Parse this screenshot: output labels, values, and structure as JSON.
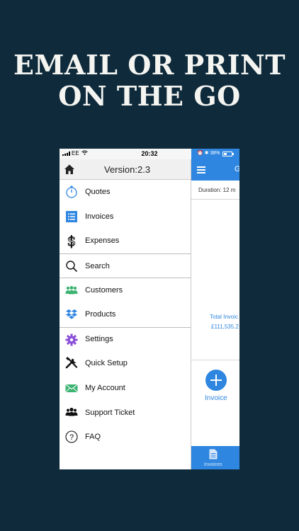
{
  "headline": {
    "line1": "EMAIL OR PRINT",
    "line2": "ON THE GO"
  },
  "status_bar": {
    "carrier": "EE",
    "time": "20:32",
    "battery_percent": "38%",
    "battery_level": 0.38
  },
  "drawer": {
    "version": "Version:2.3",
    "items": [
      {
        "label": "Quotes",
        "icon": "stopwatch-icon"
      },
      {
        "label": "Invoices",
        "icon": "list-icon"
      },
      {
        "label": "Expenses",
        "icon": "dollar-icon"
      },
      {
        "label": "Search",
        "icon": "search-icon"
      },
      {
        "label": "Customers",
        "icon": "people-icon"
      },
      {
        "label": "Products",
        "icon": "dropbox-icon"
      },
      {
        "label": "Settings",
        "icon": "gear-icon"
      },
      {
        "label": "Quick Setup",
        "icon": "tools-icon"
      },
      {
        "label": "My Account",
        "icon": "envelope-icon"
      },
      {
        "label": "Support Ticket",
        "icon": "group-icon"
      },
      {
        "label": "FAQ",
        "icon": "question-icon"
      }
    ]
  },
  "main": {
    "title": "G",
    "duration": "Duration: 12 m",
    "total_label": "Total Invoic",
    "total_amount": "£111,535.2",
    "add_label": "Invoice",
    "tab_label": "Invoices"
  },
  "colors": {
    "background": "#0e2a3b",
    "accent": "#2e86e0"
  }
}
